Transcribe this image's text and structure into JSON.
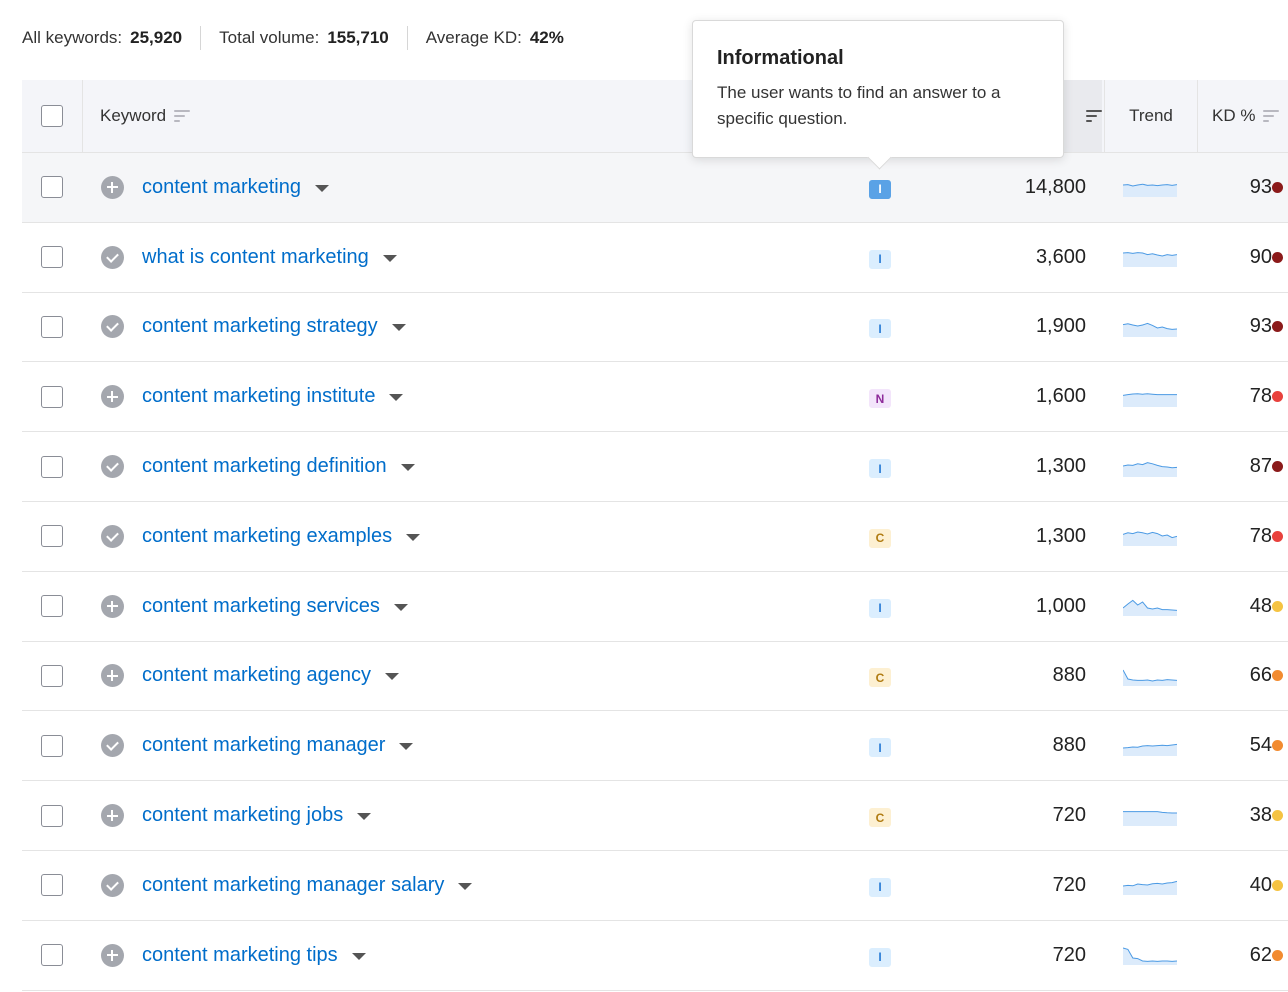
{
  "summary": [
    {
      "label": "All keywords:",
      "value": "25,920"
    },
    {
      "label": "Total volume:",
      "value": "155,710"
    },
    {
      "label": "Average KD:",
      "value": "42%"
    }
  ],
  "headers": {
    "keyword": "Keyword",
    "trend": "Trend",
    "kd": "KD %"
  },
  "tooltip": {
    "title": "Informational",
    "body": "The user wants to find an answer to a specific question."
  },
  "colors": {
    "accent": "#006dca",
    "kd_very_hard": "#8b1a1a",
    "kd_hard": "#e8413c",
    "kd_difficult": "#f28b30",
    "kd_possible": "#f5c342"
  },
  "rows": [
    {
      "keyword": "content marketing",
      "status": "plus",
      "intent": "I",
      "volume": "14,800",
      "kd": "93",
      "kd_color": "#8b1a1a",
      "trend": [
        0.6,
        0.62,
        0.55,
        0.6,
        0.64,
        0.58,
        0.6,
        0.57,
        0.6,
        0.62,
        0.58,
        0.62
      ]
    },
    {
      "keyword": "what is content marketing",
      "status": "check",
      "intent": "I",
      "volume": "3,600",
      "kd": "90",
      "kd_color": "#8b1a1a",
      "trend": [
        0.7,
        0.72,
        0.68,
        0.72,
        0.7,
        0.62,
        0.66,
        0.6,
        0.55,
        0.62,
        0.58,
        0.62
      ]
    },
    {
      "keyword": "content marketing strategy",
      "status": "check",
      "intent": "I",
      "volume": "1,900",
      "kd": "93",
      "kd_color": "#8b1a1a",
      "trend": [
        0.62,
        0.66,
        0.6,
        0.55,
        0.6,
        0.68,
        0.58,
        0.45,
        0.5,
        0.42,
        0.38,
        0.4
      ]
    },
    {
      "keyword": "content marketing institute",
      "status": "plus",
      "intent": "N",
      "volume": "1,600",
      "kd": "78",
      "kd_color": "#e8413c",
      "trend": [
        0.58,
        0.62,
        0.65,
        0.66,
        0.64,
        0.66,
        0.64,
        0.62,
        0.62,
        0.62,
        0.62,
        0.62
      ]
    },
    {
      "keyword": "content marketing definition",
      "status": "check",
      "intent": "I",
      "volume": "1,300",
      "kd": "87",
      "kd_color": "#8b1a1a",
      "trend": [
        0.55,
        0.6,
        0.58,
        0.66,
        0.62,
        0.72,
        0.66,
        0.58,
        0.52,
        0.5,
        0.46,
        0.48
      ]
    },
    {
      "keyword": "content marketing examples",
      "status": "check",
      "intent": "C",
      "volume": "1,300",
      "kd": "78",
      "kd_color": "#e8413c",
      "trend": [
        0.58,
        0.66,
        0.62,
        0.7,
        0.66,
        0.6,
        0.68,
        0.62,
        0.5,
        0.55,
        0.42,
        0.48
      ]
    },
    {
      "keyword": "content marketing services",
      "status": "plus",
      "intent": "I",
      "volume": "1,000",
      "kd": "48",
      "kd_color": "#f5c342",
      "trend": [
        0.4,
        0.6,
        0.78,
        0.55,
        0.7,
        0.4,
        0.35,
        0.4,
        0.32,
        0.32,
        0.3,
        0.28
      ]
    },
    {
      "keyword": "content marketing agency",
      "status": "plus",
      "intent": "C",
      "volume": "880",
      "kd": "66",
      "kd_color": "#f28b30",
      "trend": [
        0.8,
        0.35,
        0.3,
        0.28,
        0.28,
        0.3,
        0.25,
        0.3,
        0.28,
        0.32,
        0.3,
        0.28
      ]
    },
    {
      "keyword": "content marketing manager",
      "status": "check",
      "intent": "I",
      "volume": "880",
      "kd": "54",
      "kd_color": "#f28b30",
      "trend": [
        0.4,
        0.42,
        0.45,
        0.44,
        0.5,
        0.52,
        0.5,
        0.52,
        0.54,
        0.52,
        0.55,
        0.58
      ]
    },
    {
      "keyword": "content marketing jobs",
      "status": "plus",
      "intent": "C",
      "volume": "720",
      "kd": "38",
      "kd_color": "#f5c342",
      "trend": [
        0.72,
        0.72,
        0.72,
        0.72,
        0.72,
        0.72,
        0.72,
        0.72,
        0.68,
        0.66,
        0.65,
        0.65
      ]
    },
    {
      "keyword": "content marketing manager salary",
      "status": "check",
      "intent": "I",
      "volume": "720",
      "kd": "40",
      "kd_color": "#f5c342",
      "trend": [
        0.45,
        0.48,
        0.46,
        0.55,
        0.52,
        0.5,
        0.56,
        0.58,
        0.55,
        0.6,
        0.62,
        0.68
      ]
    },
    {
      "keyword": "content marketing tips",
      "status": "plus",
      "intent": "I",
      "volume": "720",
      "kd": "62",
      "kd_color": "#f28b30",
      "trend": [
        0.85,
        0.78,
        0.35,
        0.32,
        0.2,
        0.18,
        0.2,
        0.18,
        0.2,
        0.2,
        0.18,
        0.2
      ]
    }
  ]
}
